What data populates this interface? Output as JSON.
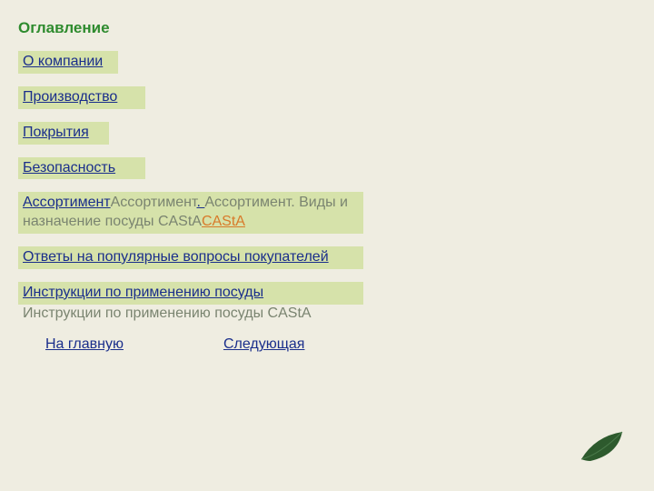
{
  "title": "Оглавление",
  "items": {
    "about": {
      "text": "О компании"
    },
    "production": {
      "text": "Производство"
    },
    "coating": {
      "text": "Покрытия"
    },
    "safety": {
      "text": "Безопасность"
    },
    "assortment": {
      "link": "Ассортимент",
      "plain1": "Ассортимент",
      "dot": ". ",
      "plain2": "Ассортимент. Виды и назначение посуды CAStA",
      "orange": "CAStA"
    },
    "faq": {
      "text": "Ответы на популярные вопросы покупателей"
    },
    "instructions": {
      "link": "Инструкции по применению посуды",
      "plain": "Инструкции по применению посуды CAStA"
    }
  },
  "footer": {
    "home": "На главную",
    "next": "Следующая"
  }
}
